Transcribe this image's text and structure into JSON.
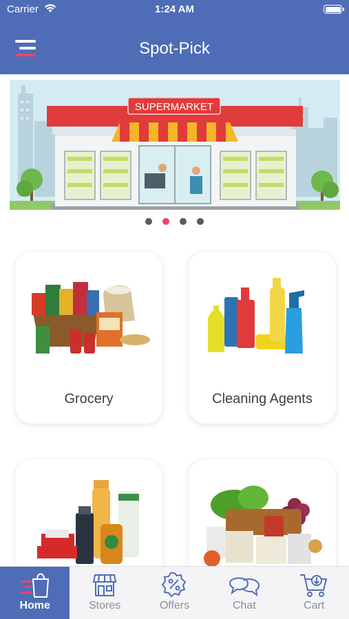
{
  "status_bar": {
    "carrier": "Carrier",
    "time": "1:24 AM"
  },
  "header": {
    "title": "Spot-Pick",
    "menu_icon": "hamburger-menu-icon"
  },
  "banner": {
    "sign_text": "SUPERMARKET",
    "slide_count": 4,
    "active_slide": 2
  },
  "categories": [
    {
      "label": "Grocery"
    },
    {
      "label": "Cleaning Agents"
    },
    {
      "label": ""
    },
    {
      "label": ""
    }
  ],
  "tabs": [
    {
      "label": "Home",
      "icon": "home-bag-icon",
      "active": true
    },
    {
      "label": "Stores",
      "icon": "store-icon",
      "active": false
    },
    {
      "label": "Offers",
      "icon": "offer-percent-icon",
      "active": false
    },
    {
      "label": "Chat",
      "icon": "chat-bubbles-icon",
      "active": false
    },
    {
      "label": "Cart",
      "icon": "cart-icon",
      "active": false
    }
  ],
  "colors": {
    "primary": "#4f6db6",
    "accent": "#e8456b",
    "tab_inactive": "#8a8f9a"
  }
}
